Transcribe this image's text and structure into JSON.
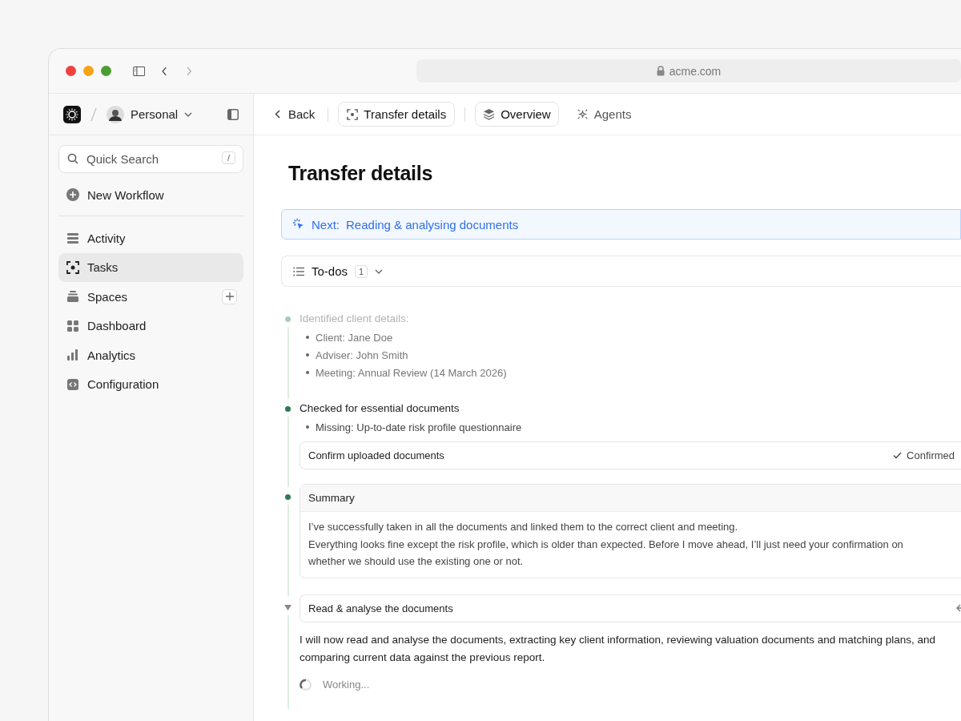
{
  "browser": {
    "url": "acme.com"
  },
  "sidebar": {
    "workspace": "Personal",
    "search": {
      "placeholder": "Quick Search",
      "shortcut": "/"
    },
    "new_workflow": "New Workflow",
    "items": [
      {
        "label": "Activity",
        "selected": false,
        "add_button": false
      },
      {
        "label": "Tasks",
        "selected": true,
        "add_button": false
      },
      {
        "label": "Spaces",
        "selected": false,
        "add_button": true
      },
      {
        "label": "Dashboard",
        "selected": false,
        "add_button": false
      },
      {
        "label": "Analytics",
        "selected": false,
        "add_button": false
      },
      {
        "label": "Configuration",
        "selected": false,
        "add_button": false
      }
    ]
  },
  "toolbar": {
    "back": "Back",
    "breadcrumb": "Transfer details",
    "tabs": [
      {
        "label": "Overview",
        "selected": true
      },
      {
        "label": "Agents",
        "selected": false
      }
    ]
  },
  "page": {
    "title": "Transfer details",
    "next": {
      "label": "Next:",
      "text": "Reading & analysing documents"
    },
    "todos": {
      "label": "To-dos",
      "count": "1"
    }
  },
  "steps": [
    {
      "kind": "list",
      "faded": true,
      "heading": "Identified client details:",
      "bullets": [
        "Client: Jane Doe",
        "Adviser: John Smith",
        "Meeting: Annual Review (14 March 2026)"
      ]
    },
    {
      "kind": "list",
      "faded": false,
      "heading": "Checked for essential documents",
      "bullets": [
        "Missing: Up-to-date risk profile questionnaire"
      ],
      "action": {
        "label": "Confirm uploaded documents",
        "status": "Confirmed"
      }
    },
    {
      "kind": "card",
      "title": "Summary",
      "paragraphs": [
        "I’ve successfully taken in all the documents and linked them to the correct client and meeting.",
        "Everything looks fine except the risk profile, which is older than expected. Before I move ahead, I’ll just need your confirmation on whether we should use the existing one or not."
      ]
    },
    {
      "kind": "task",
      "expanded": true,
      "title": "Read & analyse the documents",
      "text": "I will now read and analyse the documents, extracting key client information, reviewing valuation documents and matching plans, and comparing current data against the previous report.",
      "status": "Working..."
    }
  ]
}
